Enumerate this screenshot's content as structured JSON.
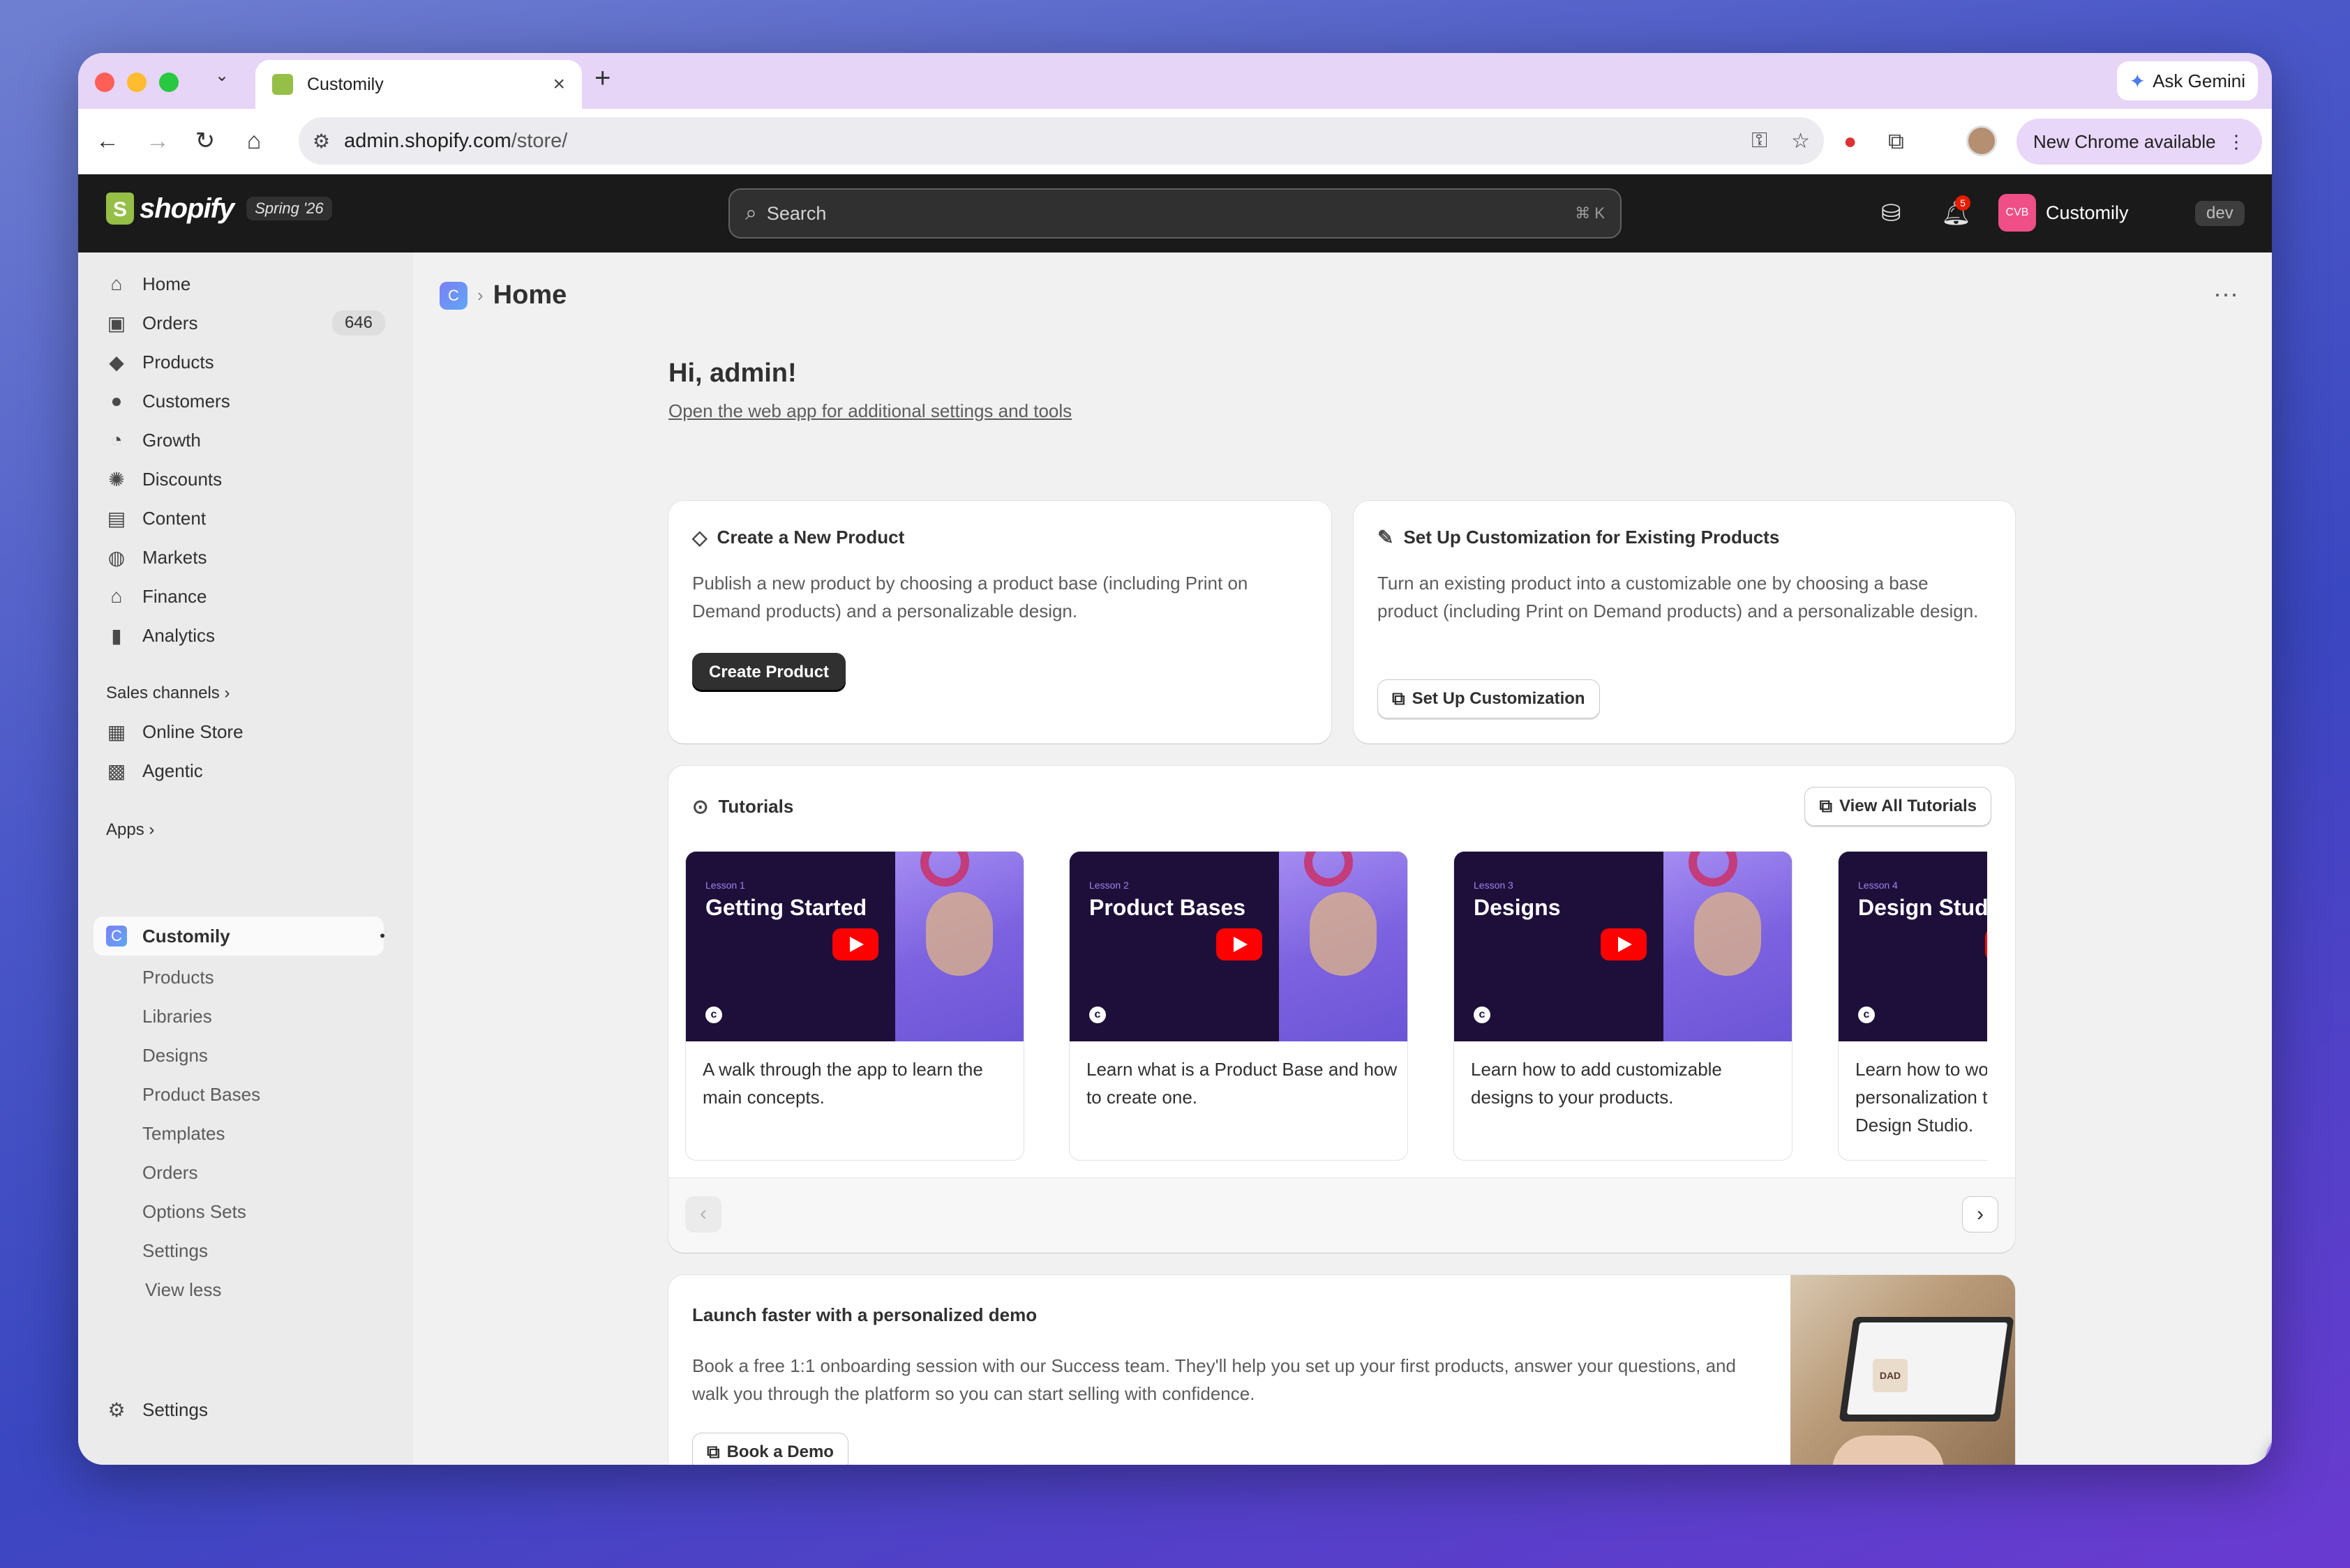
{
  "browser": {
    "tab_title": "Customily",
    "tab_close": "×",
    "new_tab": "+",
    "ask_gemini": "Ask Gemini",
    "url_domain": "admin.shopify.com",
    "url_path": "/store/",
    "new_chrome": "New Chrome available",
    "menu_dots": "⋮"
  },
  "shopify": {
    "logo_text": "shopify",
    "edition": "Spring '26",
    "search_placeholder": "Search",
    "search_shortcut": "⌘  K",
    "notifications_count": "5",
    "store_avatar": "CVB",
    "store_name": "Customily",
    "env_badge": "dev"
  },
  "sidebar": {
    "main_items": [
      {
        "label": "Home",
        "icon": "home-icon"
      },
      {
        "label": "Orders",
        "icon": "orders-icon",
        "count": "646"
      },
      {
        "label": "Products",
        "icon": "tag-icon"
      },
      {
        "label": "Customers",
        "icon": "person-icon"
      },
      {
        "label": "Growth",
        "icon": "gauge-icon"
      },
      {
        "label": "Discounts",
        "icon": "discount-icon"
      },
      {
        "label": "Content",
        "icon": "content-icon"
      },
      {
        "label": "Markets",
        "icon": "globe-icon"
      },
      {
        "label": "Finance",
        "icon": "bank-icon"
      },
      {
        "label": "Analytics",
        "icon": "bar-chart-icon"
      }
    ],
    "sales_channels_label": "Sales channels",
    "channels": [
      {
        "label": "Online Store",
        "icon": "store-icon"
      },
      {
        "label": "Agentic",
        "icon": "robot-icon"
      }
    ],
    "apps_label": "Apps",
    "app_name": "Customily",
    "app_subitems": [
      "Products",
      "Libraries",
      "Designs",
      "Product Bases",
      "Templates",
      "Orders",
      "Options Sets",
      "Settings"
    ],
    "view_less": "View less",
    "settings": "Settings"
  },
  "main": {
    "breadcrumb_sep": "›",
    "page_title": "Home",
    "greeting": "Hi, admin!",
    "web_app_link": "Open the web app for additional settings and tools",
    "create_card": {
      "title": "Create a New Product",
      "body": "Publish a new product by choosing a product base (including Print on Demand products) and a personalizable design.",
      "button": "Create Product"
    },
    "setup_card": {
      "title": "Set Up Customization for Existing Products",
      "body": "Turn an existing product into a customizable one by choosing a base product (including Print on Demand products) and a personalizable design.",
      "button": "Set Up Customization"
    },
    "tutorials": {
      "title": "Tutorials",
      "view_all": "View All Tutorials",
      "items": [
        {
          "lesson": "Lesson 1",
          "title": "Getting Started",
          "desc": "A walk through the app to learn the main concepts."
        },
        {
          "lesson": "Lesson 2",
          "title": "Product Bases",
          "desc": "Learn what is a Product Base and how to create one."
        },
        {
          "lesson": "Lesson 3",
          "title": "Designs",
          "desc": "Learn how to add customizable designs to your products."
        },
        {
          "lesson": "Lesson 4",
          "title": "Design Studio",
          "desc": "Learn how to work with personalization through Customily's Design Studio."
        }
      ]
    },
    "demo": {
      "title": "Launch faster with a personalized demo",
      "body": "Book a free 1:1 onboarding session with our Success team. They'll help you set up your first products, answer your questions, and walk you through the platform so you can start selling with confidence.",
      "button": "Book a Demo",
      "image_mug_text": "DAD"
    }
  },
  "colors": {
    "shopify_bar": "#1a1a1a",
    "brand_green": "#95bf47",
    "store_pink": "#ef4f86",
    "tutorial_dark": "#1e0f3a",
    "youtube_red": "#ff0000",
    "chat_purple": "#a98cf0"
  }
}
